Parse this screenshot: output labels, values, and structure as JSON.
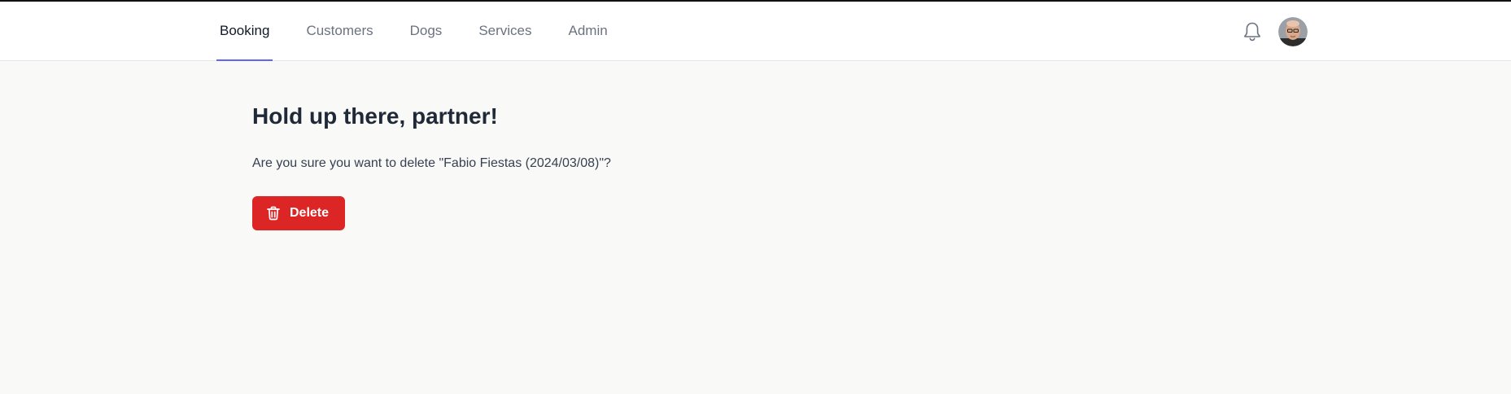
{
  "nav": {
    "items": [
      {
        "label": "Booking",
        "active": true
      },
      {
        "label": "Customers",
        "active": false
      },
      {
        "label": "Dogs",
        "active": false
      },
      {
        "label": "Services",
        "active": false
      },
      {
        "label": "Admin",
        "active": false
      }
    ]
  },
  "header": {
    "notifications_icon": "bell-icon",
    "avatar_icon": "user-avatar"
  },
  "main": {
    "title": "Hold up there, partner!",
    "message": "Are you sure you want to delete \"Fabio Fiestas (2024/03/08)\"?",
    "delete_label": "Delete",
    "delete_icon": "trash-icon"
  },
  "colors": {
    "accent": "#6366f1",
    "danger": "#dc2626",
    "background": "#f9f9f8"
  }
}
